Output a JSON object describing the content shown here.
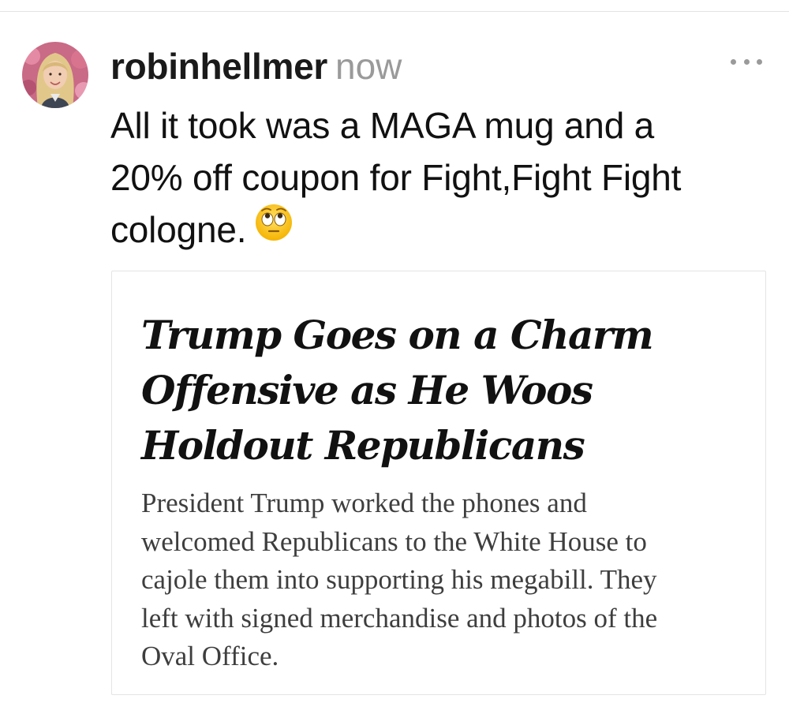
{
  "post": {
    "username": "robinhellmer",
    "timestamp": "now",
    "text_lines": [
      "All it took was a MAGA mug and a",
      "20% off coupon for Fight,Fight Fight",
      "cologne."
    ],
    "emoji": "face-with-rolling-eyes-icon",
    "more_icon": "more-horizontal-icon"
  },
  "link_card": {
    "title_lines": [
      "Trump Goes on a Charm",
      "Offensive as He Woos",
      "Holdout Republicans"
    ],
    "summary_lines": [
      "President Trump worked the phones and",
      "welcomed Republicans to the White House to",
      "cajole them into supporting his megabill. They",
      "left with signed merchandise and photos of the",
      "Oval Office."
    ]
  },
  "colors": {
    "username": "#1a1a1a",
    "timestamp": "#9a9a9a",
    "post_text": "#111111",
    "card_border": "#e4e4e4",
    "summary_text": "#3e3e3e"
  }
}
